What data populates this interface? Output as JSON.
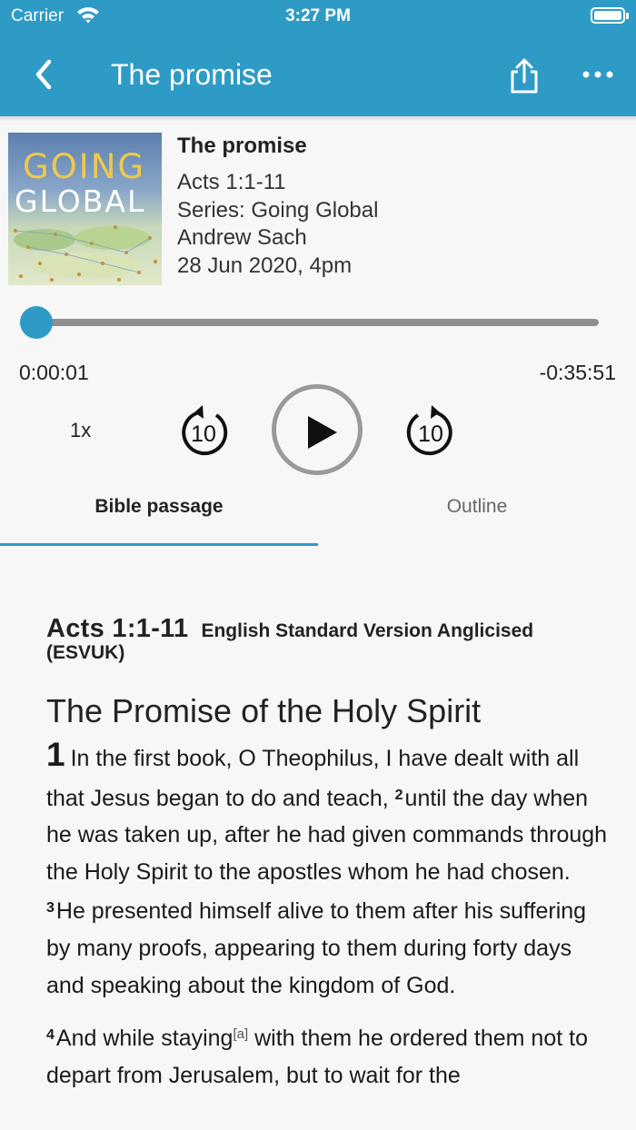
{
  "status": {
    "carrier": "Carrier",
    "time": "3:27 PM"
  },
  "nav": {
    "title": "The promise"
  },
  "artwork": {
    "line1": "GOING",
    "line2": "GLOBAL"
  },
  "sermon": {
    "title": "The promise",
    "passage": "Acts 1:1-11",
    "series": "Series: Going Global",
    "speaker": "Andrew Sach",
    "date": "28 Jun 2020, 4pm"
  },
  "player": {
    "progress_fraction": 0.0005,
    "elapsed": "0:00:01",
    "remaining": "-0:35:51",
    "speed": "1x",
    "skip_back": "10",
    "skip_forward": "10"
  },
  "tabs": [
    {
      "label": "Bible passage",
      "selected": true
    },
    {
      "label": "Outline",
      "selected": false
    }
  ],
  "bible": {
    "reference": "Acts 1:1-11",
    "version_part1": "English Standard Version Anglicised",
    "version_part2": "(ESVUK)",
    "heading": "The Promise of the Holy Spirit",
    "chapter": "1",
    "v1": "In the first book, O Theophilus, I have dealt with all that Jesus began to do and teach,",
    "v2_num": "2",
    "v2": "until the day when he was taken up, after he had given commands through the Holy Spirit to the apostles whom he had chosen.",
    "v3_num": "3",
    "v3": "He presented himself alive to them after his suffering by many proofs, appearing to them during forty days and speaking about the kingdom of God.",
    "v4_num": "4",
    "v4a": "And while staying",
    "footnote": "[a]",
    "v4b": "with them he ordered them not to depart from Jerusalem, but to wait for the"
  },
  "colors": {
    "accent": "#2e9bc6",
    "track": "#8e8e8e",
    "background": "#f7f7f7"
  }
}
